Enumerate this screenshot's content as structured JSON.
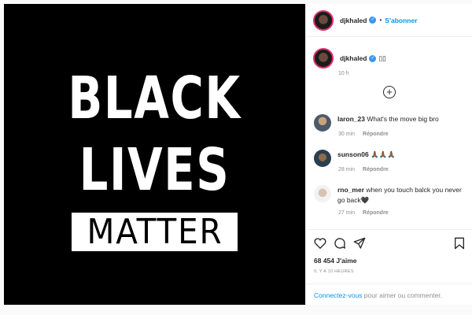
{
  "post": {
    "image_lines": [
      "BLACK",
      "LIVES",
      "MATTER"
    ]
  },
  "header": {
    "username": "djkhaled",
    "separator": "•",
    "follow_label": "S'abonner"
  },
  "caption": {
    "username": "djkhaled",
    "text": "▯▯",
    "time": "10 h"
  },
  "comments": [
    {
      "user": "laron_23",
      "text": "What's the move big bro",
      "time": "30 min",
      "reply": "Répondre"
    },
    {
      "user": "sunson06",
      "text": "🙏🏾🙏🏾🙏🏾",
      "time": "28 min",
      "reply": "Répondre"
    },
    {
      "user": "rno_mer",
      "text": "when you touch balck you never go back🖤",
      "time": "27 min",
      "reply": "Répondre"
    }
  ],
  "footer": {
    "likes": "68 454 J'aime",
    "posted": "IL Y A 10 HEURES",
    "login_link": "Connectez-vous",
    "login_rest": " pour aimer ou commenter."
  },
  "icons": [
    "heart-icon",
    "comment-icon",
    "share-icon",
    "bookmark-icon",
    "add-comment-icon",
    "verified-icon"
  ],
  "colors": {
    "accent": "#0095f6",
    "verified": "#3897f0",
    "muted": "#8e8e8e"
  }
}
